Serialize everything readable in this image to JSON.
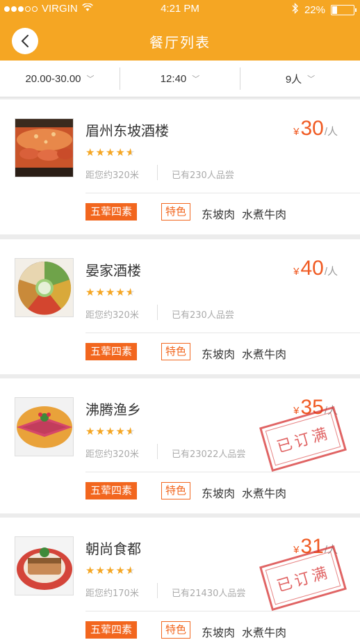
{
  "status_bar": {
    "carrier": "VIRGIN",
    "time": "4:21 PM",
    "battery": "22%",
    "battery_level": 0.22
  },
  "nav": {
    "title": "餐厅列表"
  },
  "filters": [
    {
      "label": "20.00-30.00"
    },
    {
      "label": "12:40"
    },
    {
      "label": "9人"
    }
  ],
  "restaurants": [
    {
      "name": "眉州东坡酒楼",
      "price_symbol": "¥",
      "price": "30",
      "price_unit": "/人",
      "rating": 4.5,
      "distance": "距您约320米",
      "tried": "已有230人品尝",
      "type_tag": "五荤四素",
      "special_tag": "特色",
      "dishes": [
        "东坡肉",
        "水煮牛肉"
      ],
      "stamp": ""
    },
    {
      "name": "晏家酒楼",
      "price_symbol": "¥",
      "price": "40",
      "price_unit": "/人",
      "rating": 4.5,
      "distance": "距您约320米",
      "tried": "已有230人品尝",
      "type_tag": "五荤四素",
      "special_tag": "特色",
      "dishes": [
        "东坡肉",
        "水煮牛肉"
      ],
      "stamp": ""
    },
    {
      "name": "沸腾渔乡",
      "price_symbol": "¥",
      "price": "35",
      "price_unit": "/人",
      "rating": 4.5,
      "distance": "距您约320米",
      "tried": "已有23022人品尝",
      "type_tag": "五荤四素",
      "special_tag": "特色",
      "dishes": [
        "东坡肉",
        "水煮牛肉"
      ],
      "stamp": "已订满"
    },
    {
      "name": "朝尚食都",
      "price_symbol": "¥",
      "price": "31",
      "price_unit": "/人",
      "rating": 4.5,
      "distance": "距您约170米",
      "tried": "已有21430人品尝",
      "type_tag": "五荤四素",
      "special_tag": "特色",
      "dishes": [
        "东坡肉",
        "水煮牛肉"
      ],
      "stamp": "已订满"
    }
  ],
  "colors": {
    "accent": "#f5a623",
    "price": "#f05a22",
    "tag": "#f2661e",
    "stamp": "#d63030"
  }
}
